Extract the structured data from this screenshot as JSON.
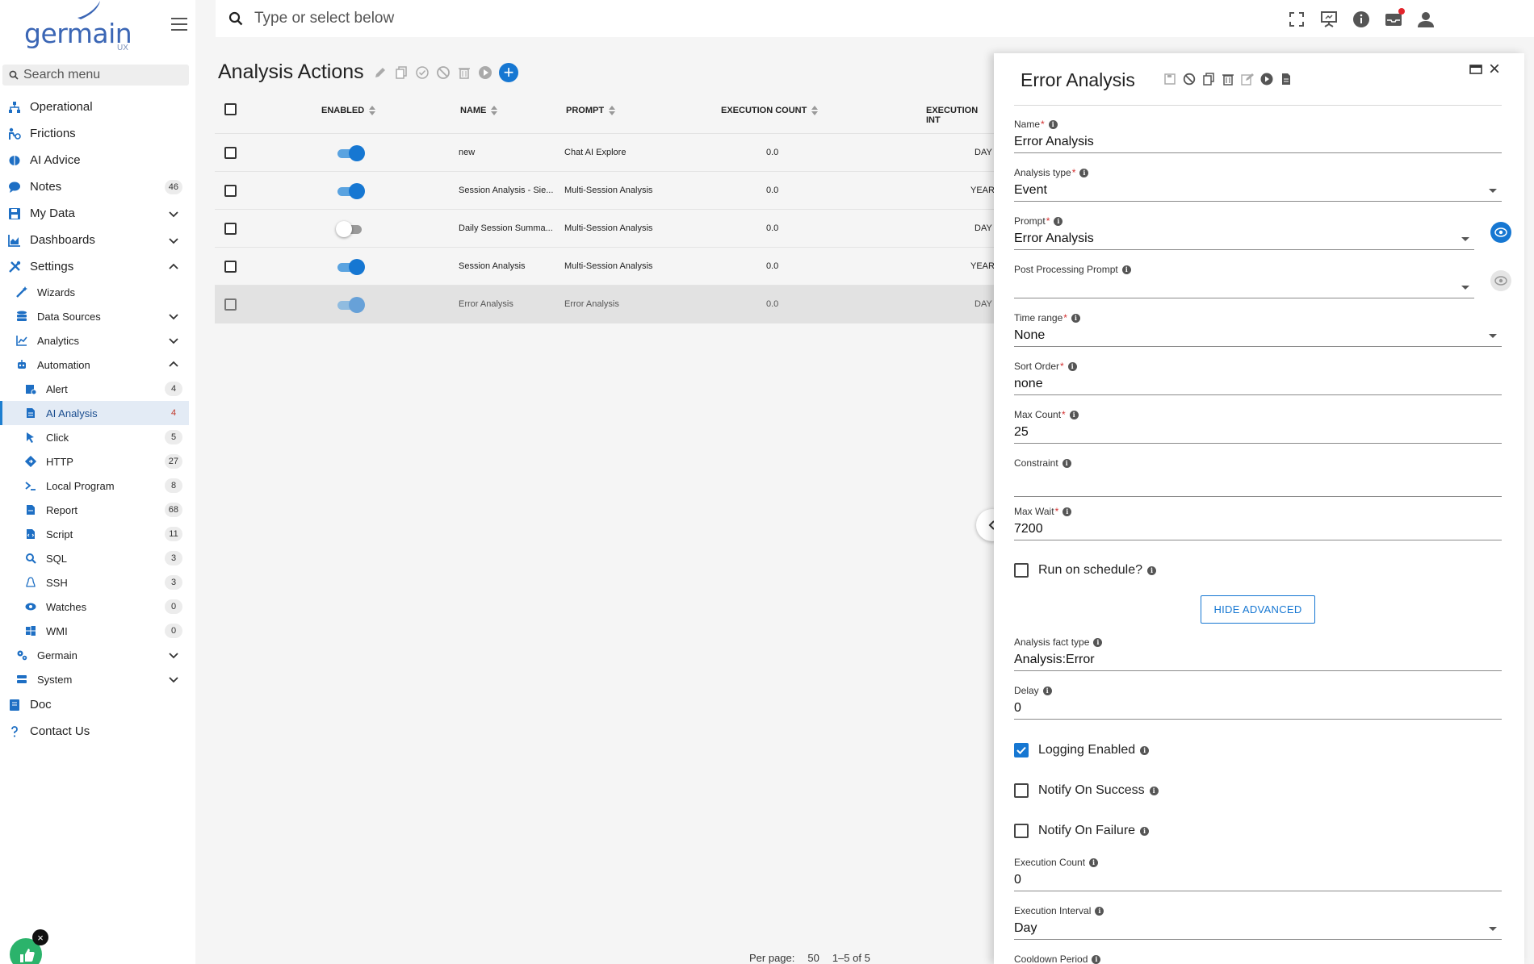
{
  "brand": {
    "logo_text": "germain",
    "logo_sub": "UX"
  },
  "sidebar": {
    "search_placeholder": "Search menu",
    "items": [
      {
        "label": "Operational",
        "icon": "sitemap-icon",
        "level": 0
      },
      {
        "label": "Frictions",
        "icon": "friction-icon",
        "level": 0
      },
      {
        "label": "AI Advice",
        "icon": "brain-icon",
        "level": 0
      },
      {
        "label": "Notes",
        "icon": "comment-icon",
        "level": 0,
        "badge": "46"
      },
      {
        "label": "My Data",
        "icon": "save-icon",
        "level": 0,
        "chevron": "down"
      },
      {
        "label": "Dashboards",
        "icon": "chart-area-icon",
        "level": 0,
        "chevron": "down"
      },
      {
        "label": "Settings",
        "icon": "tools-icon",
        "level": 0,
        "chevron": "up"
      },
      {
        "label": "Wizards",
        "icon": "wand-icon",
        "level": 1
      },
      {
        "label": "Data Sources",
        "icon": "database-icon",
        "level": 1,
        "chevron": "down"
      },
      {
        "label": "Analytics",
        "icon": "line-chart-icon",
        "level": 1,
        "chevron": "down"
      },
      {
        "label": "Automation",
        "icon": "robot-icon",
        "level": 1,
        "chevron": "up"
      },
      {
        "label": "Alert",
        "icon": "alert-icon",
        "level": 2,
        "badge": "4"
      },
      {
        "label": "AI Analysis",
        "icon": "document-icon",
        "level": 2,
        "badge": "4",
        "active": true
      },
      {
        "label": "Click",
        "icon": "pointer-icon",
        "level": 2,
        "badge": "5"
      },
      {
        "label": "HTTP",
        "icon": "http-icon",
        "level": 2,
        "badge": "27"
      },
      {
        "label": "Local Program",
        "icon": "terminal-icon",
        "level": 2,
        "badge": "8"
      },
      {
        "label": "Report",
        "icon": "report-icon",
        "level": 2,
        "badge": "68"
      },
      {
        "label": "Script",
        "icon": "script-icon",
        "level": 2,
        "badge": "11"
      },
      {
        "label": "SQL",
        "icon": "search-icon",
        "level": 2,
        "badge": "3"
      },
      {
        "label": "SSH",
        "icon": "linux-icon",
        "level": 2,
        "badge": "3"
      },
      {
        "label": "Watches",
        "icon": "eye-icon",
        "level": 2,
        "badge": "0"
      },
      {
        "label": "WMI",
        "icon": "windows-icon",
        "level": 2,
        "badge": "0"
      },
      {
        "label": "Germain",
        "icon": "cogs-icon",
        "level": 1,
        "chevron": "down"
      },
      {
        "label": "System",
        "icon": "server-icon",
        "level": 1,
        "chevron": "down"
      },
      {
        "label": "Doc",
        "icon": "book-icon",
        "level": 0
      },
      {
        "label": "Contact Us",
        "icon": "question-icon",
        "level": 0
      }
    ],
    "feedback_close": "×"
  },
  "topbar": {
    "search_placeholder": "Type or select below",
    "icons": [
      "fullscreen-icon",
      "presentation-icon",
      "info-icon",
      "inbox-icon",
      "user-icon"
    ]
  },
  "main": {
    "title": "Analysis Actions",
    "add_label": "+",
    "columns": [
      "ENABLED",
      "NAME",
      "PROMPT",
      "EXECUTION COUNT",
      "EXECUTION INT"
    ],
    "rows": [
      {
        "enabled": true,
        "name": "new",
        "prompt": "Chat AI Explore",
        "count": "0.0",
        "interval": "DAY"
      },
      {
        "enabled": true,
        "name": "Session Analysis - Sie...",
        "prompt": "Multi-Session Analysis",
        "count": "0.0",
        "interval": "YEAR"
      },
      {
        "enabled": false,
        "name": "Daily Session Summa...",
        "prompt": "Multi-Session Analysis",
        "count": "0.0",
        "interval": "DAY"
      },
      {
        "enabled": true,
        "name": "Session Analysis",
        "prompt": "Multi-Session Analysis",
        "count": "0.0",
        "interval": "YEAR"
      },
      {
        "enabled": true,
        "name": "Error Analysis",
        "prompt": "Error Analysis",
        "count": "0.0",
        "interval": "DAY",
        "selected": true
      }
    ],
    "pager": {
      "per_page_label": "Per page:",
      "per_page": "50",
      "range": "1–5 of 5"
    }
  },
  "panel": {
    "title": "Error Analysis",
    "fields": {
      "name": {
        "label": "Name",
        "value": "Error Analysis"
      },
      "analysis_type": {
        "label": "Analysis type",
        "value": "Event"
      },
      "prompt": {
        "label": "Prompt",
        "value": "Error Analysis"
      },
      "post_prompt": {
        "label": "Post Processing Prompt",
        "value": ""
      },
      "time_range": {
        "label": "Time range",
        "value": "None"
      },
      "sort_order": {
        "label": "Sort Order",
        "value": "none"
      },
      "max_count": {
        "label": "Max Count",
        "value": "25"
      },
      "constraint": {
        "label": "Constraint",
        "value": ""
      },
      "max_wait": {
        "label": "Max Wait",
        "value": "7200"
      },
      "fact_type": {
        "label": "Analysis fact type",
        "value": "Analysis:Error"
      },
      "delay": {
        "label": "Delay",
        "value": "0"
      },
      "exec_count": {
        "label": "Execution Count",
        "value": "0"
      },
      "exec_interval": {
        "label": "Execution Interval",
        "value": "Day"
      },
      "cooldown": {
        "label": "Cooldown Period",
        "value": ""
      }
    },
    "checks": {
      "run_schedule": {
        "label": "Run on schedule?",
        "checked": false
      },
      "logging": {
        "label": "Logging Enabled",
        "checked": true
      },
      "notify_success": {
        "label": "Notify On Success",
        "checked": false
      },
      "notify_failure": {
        "label": "Notify On Failure",
        "checked": false
      }
    },
    "hide_advanced_label": "HIDE ADVANCED",
    "close_label": "×",
    "info_glyph": "i",
    "required_mark": "*"
  },
  "colors": {
    "accent": "#1677d2",
    "active_bg": "#e3ebf5",
    "required": "#d32f2f",
    "notify_dot": "#e3242b",
    "feedback": "#2bb36b"
  }
}
